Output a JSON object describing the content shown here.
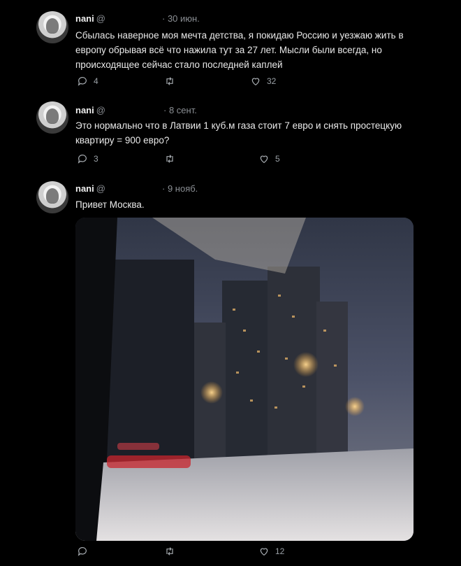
{
  "tweets": [
    {
      "name": "nani",
      "handle": "@",
      "date": "· 30 июн.",
      "text": "Сбылась наверное моя мечта детства, я покидаю Россию и уезжаю жить в европу обрывая всё что нажила тут за 27 лет. Мысли были всегда, но происходящее сейчас стало последней каплей",
      "reply_count": "4",
      "retweet_count": "",
      "like_count": "32"
    },
    {
      "name": "nani",
      "handle": "@",
      "date": "· 8 сент.",
      "text": "Это нормально что в Латвии 1 куб.м газа стоит 7 евро и снять простецкую квартиру = 900 евро?",
      "reply_count": "3",
      "retweet_count": "",
      "like_count": "5"
    },
    {
      "name": "nani",
      "handle": "@",
      "date": "· 9 нояб.",
      "text": "Привет Москва.",
      "reply_count": "",
      "retweet_count": "",
      "like_count": "12"
    }
  ],
  "icons": {
    "reply": "reply-icon",
    "retweet": "retweet-icon",
    "like": "heart-icon"
  },
  "colors": {
    "background": "#000000",
    "text": "#e7e9ea",
    "muted": "#8b8f94"
  }
}
